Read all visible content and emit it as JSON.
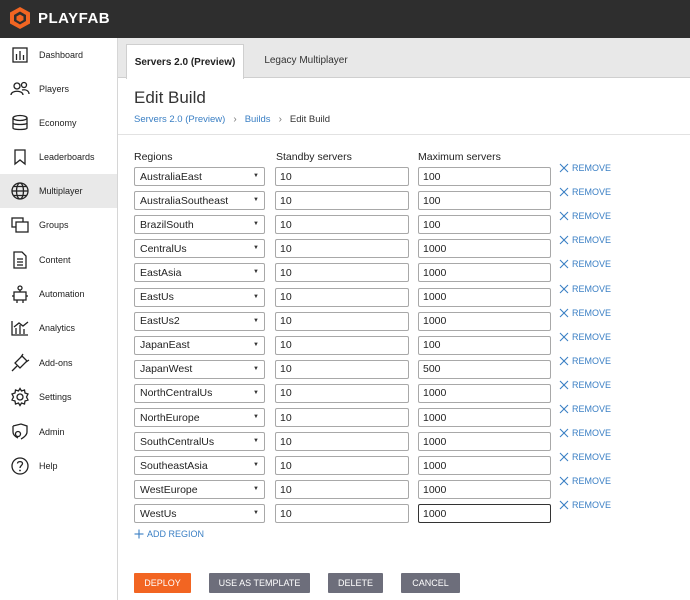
{
  "app": {
    "logo_text": "PLAYFAB"
  },
  "sidebar": {
    "items": [
      {
        "label": "Dashboard",
        "icon": "dashboard-icon"
      },
      {
        "label": "Players",
        "icon": "players-icon"
      },
      {
        "label": "Economy",
        "icon": "economy-icon"
      },
      {
        "label": "Leaderboards",
        "icon": "leaderboards-icon"
      },
      {
        "label": "Multiplayer",
        "icon": "multiplayer-icon",
        "active": true
      },
      {
        "label": "Groups",
        "icon": "groups-icon"
      },
      {
        "label": "Content",
        "icon": "content-icon"
      },
      {
        "label": "Automation",
        "icon": "automation-icon"
      },
      {
        "label": "Analytics",
        "icon": "analytics-icon"
      },
      {
        "label": "Add-ons",
        "icon": "addons-icon"
      },
      {
        "label": "Settings",
        "icon": "settings-icon"
      },
      {
        "label": "Admin",
        "icon": "admin-icon"
      },
      {
        "label": "Help",
        "icon": "help-icon"
      }
    ]
  },
  "tabs": [
    {
      "label": "Servers 2.0 (Preview)",
      "active": true
    },
    {
      "label": "Legacy Multiplayer",
      "active": false
    }
  ],
  "page": {
    "title": "Edit Build",
    "breadcrumb": [
      "Servers 2.0 (Preview)",
      "Builds",
      "Edit Build"
    ]
  },
  "table": {
    "headers": {
      "regions": "Regions",
      "standby": "Standby servers",
      "maximum": "Maximum servers"
    },
    "remove_label": "REMOVE",
    "rows": [
      {
        "region": "AustraliaEast",
        "standby": "10",
        "maximum": "100"
      },
      {
        "region": "AustraliaSoutheast",
        "standby": "10",
        "maximum": "100"
      },
      {
        "region": "BrazilSouth",
        "standby": "10",
        "maximum": "100"
      },
      {
        "region": "CentralUs",
        "standby": "10",
        "maximum": "1000"
      },
      {
        "region": "EastAsia",
        "standby": "10",
        "maximum": "1000"
      },
      {
        "region": "EastUs",
        "standby": "10",
        "maximum": "1000"
      },
      {
        "region": "EastUs2",
        "standby": "10",
        "maximum": "1000"
      },
      {
        "region": "JapanEast",
        "standby": "10",
        "maximum": "100"
      },
      {
        "region": "JapanWest",
        "standby": "10",
        "maximum": "500"
      },
      {
        "region": "NorthCentralUs",
        "standby": "10",
        "maximum": "1000"
      },
      {
        "region": "NorthEurope",
        "standby": "10",
        "maximum": "1000"
      },
      {
        "region": "SouthCentralUs",
        "standby": "10",
        "maximum": "1000"
      },
      {
        "region": "SoutheastAsia",
        "standby": "10",
        "maximum": "1000"
      },
      {
        "region": "WestEurope",
        "standby": "10",
        "maximum": "1000"
      },
      {
        "region": "WestUs",
        "standby": "10",
        "maximum": "1000"
      }
    ],
    "add_region_label": "ADD REGION"
  },
  "actions": {
    "deploy": "DEPLOY",
    "use_as_template": "USE AS TEMPLATE",
    "delete": "DELETE",
    "cancel": "CANCEL"
  },
  "colors": {
    "accent": "#f26522",
    "link": "#3a7fc4",
    "topbar": "#2e2e2e",
    "secondary_button": "#6d6e7b"
  }
}
